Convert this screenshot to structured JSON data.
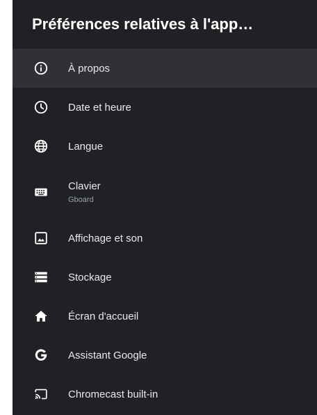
{
  "header": {
    "title": "Préférences relatives à l'app…"
  },
  "colors": {
    "background": "#202124",
    "selected": "#303134",
    "text": "#e8eaed",
    "subtext": "#9aa0a6"
  },
  "items": [
    {
      "label": "À propos",
      "icon": "info-icon",
      "selected": true
    },
    {
      "label": "Date et heure",
      "icon": "clock-icon"
    },
    {
      "label": "Langue",
      "icon": "globe-icon"
    },
    {
      "label": "Clavier",
      "sublabel": "Gboard",
      "icon": "keyboard-icon"
    },
    {
      "label": "Affichage et son",
      "icon": "display-icon"
    },
    {
      "label": "Stockage",
      "icon": "storage-icon"
    },
    {
      "label": "Écran d'accueil",
      "icon": "home-icon"
    },
    {
      "label": "Assistant Google",
      "icon": "google-icon"
    },
    {
      "label": "Chromecast built-in",
      "icon": "cast-icon"
    }
  ]
}
